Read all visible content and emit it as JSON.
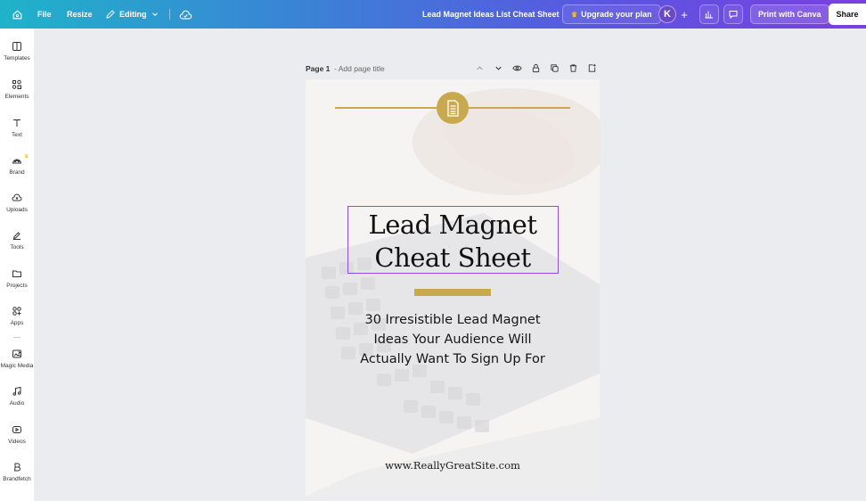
{
  "topbar": {
    "file_label": "File",
    "resize_label": "Resize",
    "editing_label": "Editing",
    "document_title": "Lead Magnet Ideas List Cheat Sheet",
    "upgrade_label": "Upgrade your plan",
    "avatar_initial": "K",
    "add_label": "+",
    "print_label": "Print with Canva",
    "share_label": "Share",
    "accent_gradient": [
      "#1fb3c9",
      "#3b82d6",
      "#5b55e0",
      "#7a3fe0"
    ]
  },
  "sidebar": {
    "items": [
      {
        "label": "Templates",
        "icon": "templates-icon"
      },
      {
        "label": "Elements",
        "icon": "elements-icon"
      },
      {
        "label": "Text",
        "icon": "text-icon"
      },
      {
        "label": "Brand",
        "icon": "brand-icon"
      },
      {
        "label": "Uploads",
        "icon": "uploads-icon"
      },
      {
        "label": "Tools",
        "icon": "tools-icon"
      },
      {
        "label": "Projects",
        "icon": "projects-icon"
      },
      {
        "label": "Apps",
        "icon": "apps-icon"
      },
      {
        "label": "Magic Media",
        "icon": "magic-media-icon"
      },
      {
        "label": "Audio",
        "icon": "audio-icon"
      },
      {
        "label": "Videos",
        "icon": "videos-icon"
      },
      {
        "label": "Brandfetch",
        "icon": "brandfetch-icon"
      }
    ]
  },
  "page_header": {
    "page_label": "Page 1",
    "title_placeholder": "- Add page title"
  },
  "design": {
    "title": "Lead Magnet Cheat Sheet",
    "title_line1": "Lead Magnet",
    "title_line2": "Cheat Sheet",
    "subtitle_line1": "30 Irresistible Lead Magnet",
    "subtitle_line2": "Ideas Your Audience Will",
    "subtitle_line3": "Actually Want To Sign Up For",
    "website": "www.ReallyGreatSite.com",
    "gold_color": "#c9a94e",
    "selection_color": "#8b4fd8"
  }
}
